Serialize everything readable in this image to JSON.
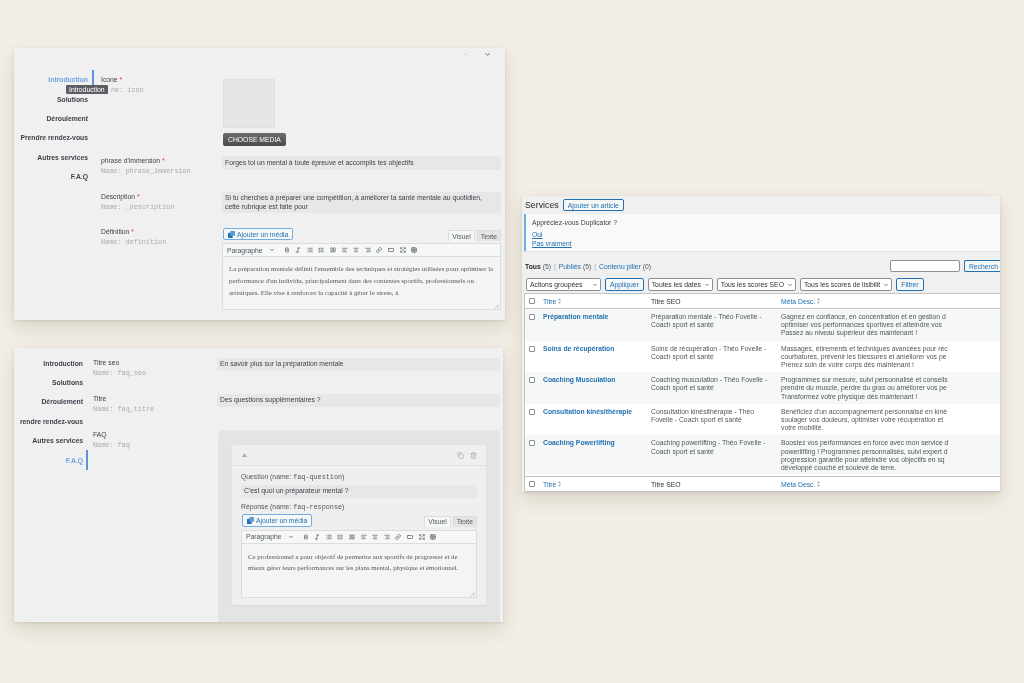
{
  "field_editor": {
    "nav": [
      {
        "label": "Introduction",
        "selected": true
      },
      {
        "label": "Solutions",
        "selected": false
      },
      {
        "label": "Déroulement",
        "selected": false
      },
      {
        "label": "Prendre rendez-vous",
        "selected": false
      },
      {
        "label": "Autres services",
        "selected": false
      },
      {
        "label": "F.A.Q",
        "selected": false
      }
    ],
    "tooltip": "Introduction",
    "fields": [
      {
        "kind": "media",
        "label": "Icone",
        "mark": "*",
        "hint": "ne: icon",
        "button": "CHOOSE MEDIA"
      },
      {
        "kind": "text",
        "label": "phrase d'immersion",
        "mark": "*",
        "hint": "Name: phrase_immersion",
        "value": "Forges toi un mental à toute épreuve et accomplis tes objectifs"
      },
      {
        "kind": "text",
        "label": "Description",
        "mark": "*",
        "hint": "Name: _description",
        "value": "Si tu cherches à préparer une compétition, à améliorer ta santé mentale au quotidien, cette rubrique est faite pour"
      },
      {
        "kind": "wysiwyg",
        "label": "Définition",
        "mark": "*",
        "hint": "Name: definition",
        "editor": {
          "add_media": "Ajouter un média",
          "tabs": [
            {
              "label": "Visuel",
              "selected": true
            },
            {
              "label": "Texte",
              "selected": false
            }
          ],
          "format": "Paragraphe",
          "content": "La préparation mentale définit l'ensemble des techniques et stratégies utilisées pour optimiser la performance d'un individu, principalement dans des contextes sportifs, professionnels ou artistiques. Elle vise à renforcer la capacité à gérer le stress, à"
        }
      }
    ]
  },
  "faq_editor": {
    "nav": [
      {
        "label": "Introduction",
        "selected": false
      },
      {
        "label": "Solutions",
        "selected": false
      },
      {
        "label": "Déroulement",
        "selected": false
      },
      {
        "label": "rendre rendez-vous",
        "selected": false
      },
      {
        "label": "Autres services",
        "selected": false
      },
      {
        "label": "F.A.Q",
        "selected": true
      }
    ],
    "fields": [
      {
        "kind": "text",
        "label": "Titre seo",
        "hint": "Name: faq_seo",
        "value": "En savoir plus sur la préparation mentale"
      },
      {
        "kind": "text",
        "label": "Titre",
        "hint": "Name: faq_titre",
        "value": "Des questions supplémentaires ?"
      },
      {
        "kind": "repeater",
        "label": "FAQ",
        "hint": "Name: faq",
        "items": [
          {
            "expanded": true,
            "question": {
              "label": "Question (name:",
              "name": "faq-question",
              "end": ")",
              "value": "C'est quoi un préparateur mental ?"
            },
            "answer": {
              "label": "Réponse (name:",
              "name": "faq-response",
              "end": ")",
              "editor": {
                "add_media": "Ajouter un média",
                "tabs": [
                  {
                    "label": "Visuel",
                    "selected": true
                  },
                  {
                    "label": "Texte",
                    "selected": false
                  }
                ],
                "format": "Paragraphe",
                "content": "Ce professionnel a pour objectif de permettre aux sportifs de progresser et de mieux gérer leurs performances sur les plans mental, physique et émotionnel."
              }
            }
          }
        ]
      }
    ]
  },
  "services_list": {
    "title": "Services",
    "add_button": "Ajouter un article",
    "notice": {
      "text": "Appréciez-vous Duplicator ?",
      "links": [
        "Oui",
        "Pas vraiment"
      ]
    },
    "views": [
      {
        "label": "Tous",
        "count": "(5)",
        "selected": true,
        "separator": "|"
      },
      {
        "label": "Publiés",
        "count": "(5)",
        "selected": false,
        "separator": "|"
      },
      {
        "label": "Contenu pilier",
        "count": "(0)",
        "selected": false
      }
    ],
    "search_button": "Recherch",
    "filters": [
      {
        "kind": "select",
        "label": "Actions groupées"
      },
      {
        "kind": "button",
        "label": "Appliquer"
      },
      {
        "kind": "select",
        "label": "Toutes les dates"
      },
      {
        "kind": "select",
        "label": "Tous les scores SEO"
      },
      {
        "kind": "select",
        "label": "Tous les scores de lisibilit"
      },
      {
        "kind": "button",
        "label": "Filtrer"
      }
    ],
    "header": {
      "checked": false,
      "columns": [
        {
          "label": "Titre",
          "sortable": true
        },
        {
          "label": "Titre SEO",
          "sortable": false
        },
        {
          "label": "Méta Desc.",
          "sortable": true
        }
      ]
    },
    "rows": [
      {
        "checked": false,
        "title": "Préparation mentale",
        "seo_title": "Préparation mentale - Théo Fovelle - Coach sport et santé",
        "meta_lines": [
          "Gagnez en confiance, en concentration et en gestion d",
          "optimiser vos performances sportives et atteindre vos",
          "Passez au niveau supérieur dès maintenant !"
        ]
      },
      {
        "checked": false,
        "title": "Soins de récupération",
        "seo_title": "Soins de récupération - Théo Fovelle - Coach sport et santé",
        "meta_lines": [
          "Massages, étirements et techniques avancées pour réc",
          "courbatures, prévenir les blessures et améliorer vos pe",
          "Prenez soin de votre corps dès maintenant !"
        ]
      },
      {
        "checked": false,
        "title": "Coaching Musculation",
        "seo_title": "Coaching musculation - Théo Fovelle - Coach sport et santé",
        "meta_lines": [
          "Programmes sur mesure, suivi personnalisé et conseils",
          "prendre du muscle, perdre du gras ou améliorer vos pe",
          "Transformez votre physique dès maintenant !"
        ]
      },
      {
        "checked": false,
        "title": "Consultation kinésithérapie",
        "seo_title": "Consultation kinésithérapie - Théo Fovelle - Coach sport et santé",
        "meta_lines": [
          "Bénéficiez d'un accompagnement personnalisé en kiné",
          "soulager vos douleurs, optimiser votre récupération et",
          "votre mobilité."
        ]
      },
      {
        "checked": false,
        "title": "Coaching Powerlifting",
        "seo_title": "Coaching powerlifting - Théo Fovelle - Coach sport et santé",
        "meta_lines": [
          "Boostez vos performances en force avec mon service d",
          "powerlifting ! Programmes personnalisés, suivi expert d",
          "progression garantie pour atteindre vos objectifs en sq",
          "développé couché et soulevé de terre."
        ]
      }
    ],
    "footer": {
      "checked": false,
      "columns": [
        {
          "label": "Titre",
          "sortable": true
        },
        {
          "label": "Titre SEO",
          "sortable": false
        },
        {
          "label": "Méta Desc.",
          "sortable": true
        }
      ]
    }
  }
}
